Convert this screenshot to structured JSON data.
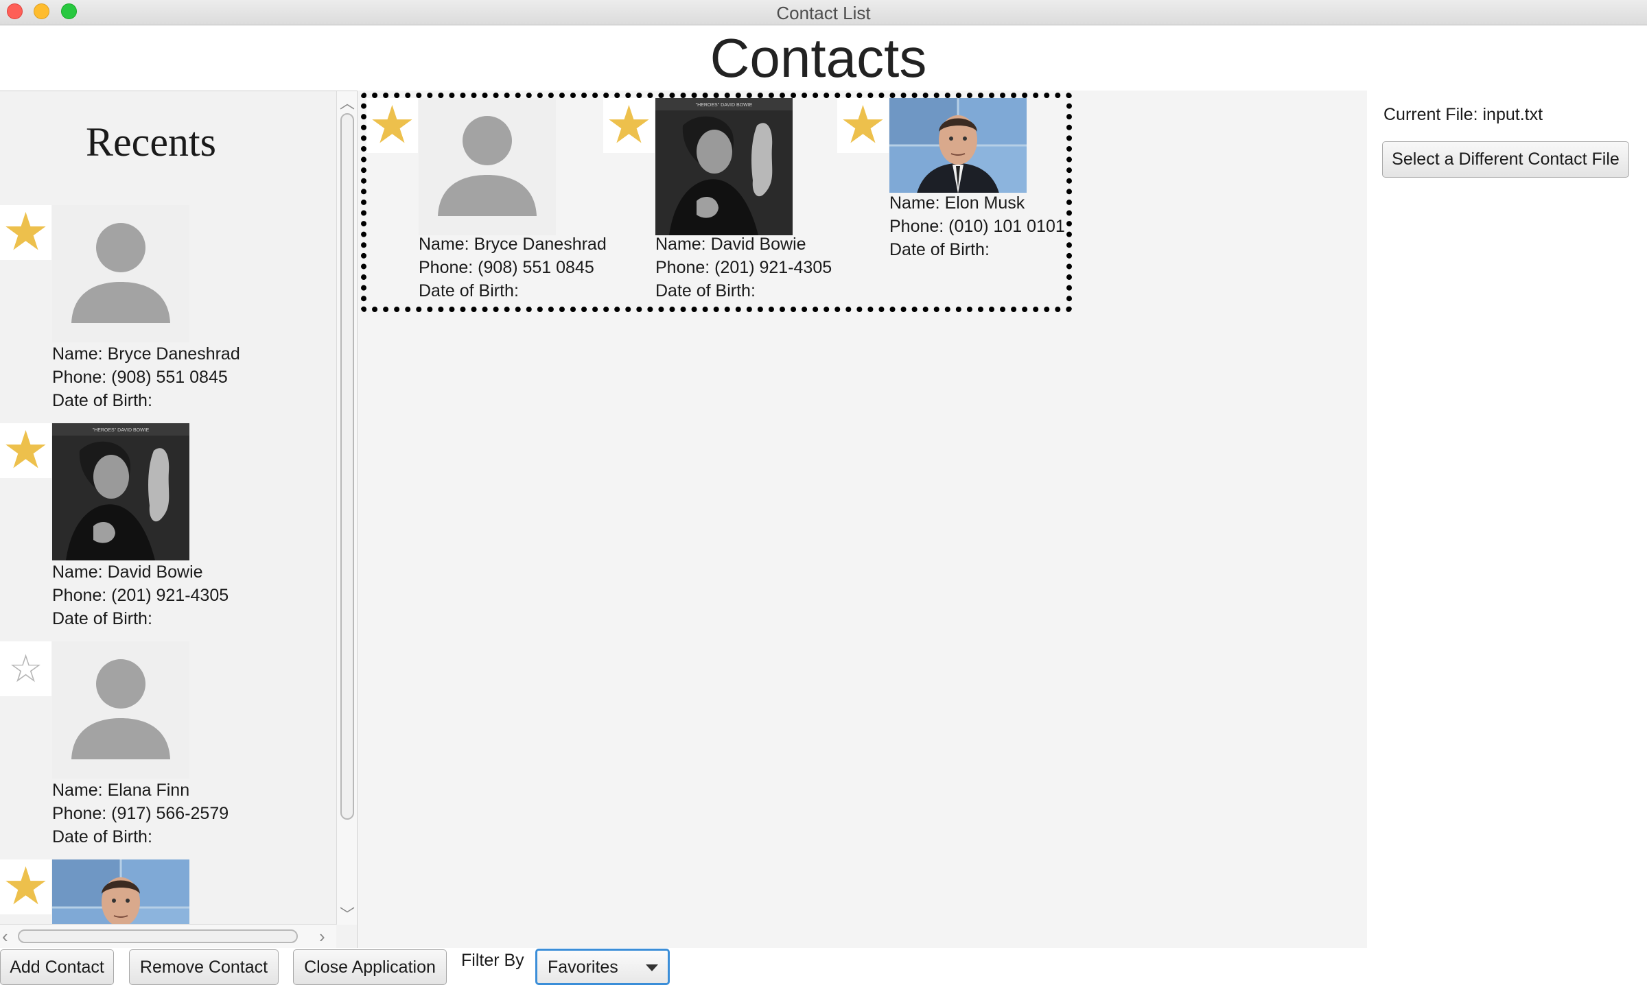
{
  "window": {
    "title": "Contact List"
  },
  "heading": "Contacts",
  "recents": {
    "title": "Recents",
    "contacts": [
      {
        "name": "Name: Bryce Daneshrad",
        "phone": "Phone: (908) 551 0845",
        "dob": "Date of Birth:",
        "favorite": true,
        "photo": "placeholder-avatar"
      },
      {
        "name": "Name: David Bowie",
        "phone": "Phone: (201) 921-4305",
        "dob": "Date of Birth:",
        "favorite": true,
        "photo": "bowie-portrait"
      },
      {
        "name": "Name: Elana Finn",
        "phone": "Phone: (917) 566-2579",
        "dob": "Date of Birth:",
        "favorite": false,
        "photo": "placeholder-avatar"
      },
      {
        "favorite": true,
        "photo": "musk-portrait"
      }
    ]
  },
  "favorites": [
    {
      "name": "Name: Bryce Daneshrad",
      "phone": "Phone: (908) 551 0845",
      "dob": "Date of Birth:",
      "photo": "placeholder-avatar"
    },
    {
      "name": "Name: David Bowie",
      "phone": "Phone: (201) 921-4305",
      "dob": "Date of Birth:",
      "photo": "bowie-portrait"
    },
    {
      "name": "Name: Elon Musk",
      "phone": "Phone: (010) 101 0101",
      "dob": "Date of Birth:",
      "photo": "musk-portrait"
    }
  ],
  "file": {
    "current_label": "Current File: input.txt",
    "select_button": "Select a Different Contact File"
  },
  "bottom": {
    "add_label": "Add Contact",
    "remove_label": "Remove Contact",
    "close_label": "Close Application",
    "filter_label": "Filter By",
    "filter_value": "Favorites"
  },
  "colors": {
    "star": "#edc04c",
    "focus": "#3b8ed8",
    "close": "#fe5f57",
    "minimize": "#febc2e",
    "maximize": "#28c840"
  }
}
